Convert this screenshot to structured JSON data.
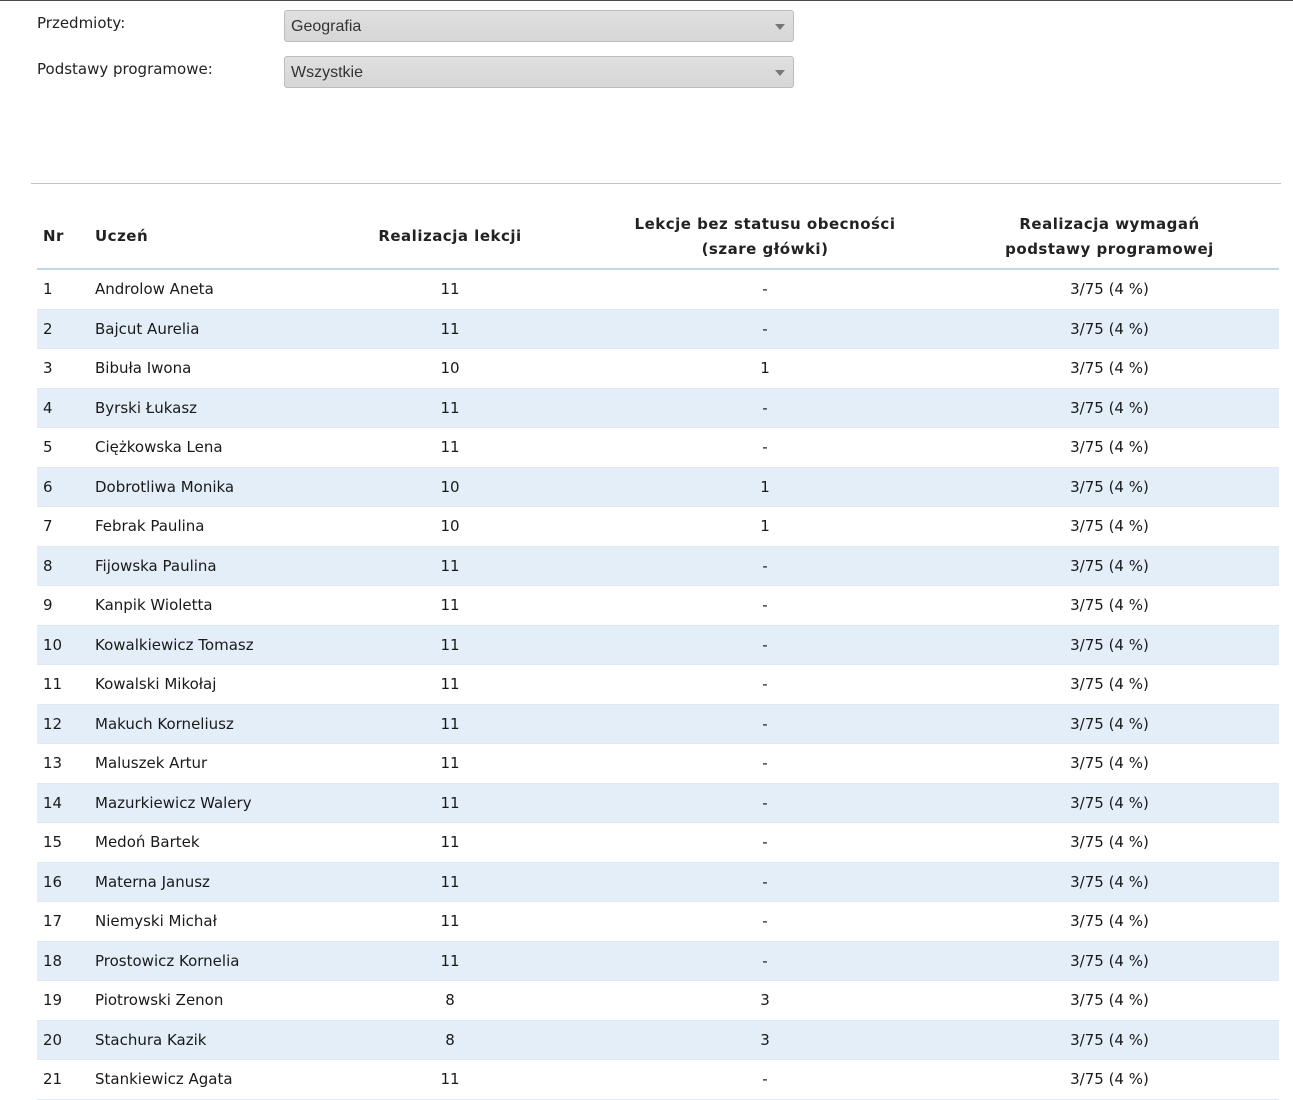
{
  "filters": {
    "subject": {
      "label": "Przedmioty:",
      "value": "Geografia"
    },
    "curriculum": {
      "label": "Podstawy programowe:",
      "value": "Wszystkie"
    }
  },
  "table": {
    "headers": {
      "nr": "Nr",
      "student": "Uczeń",
      "lessons": "Realizacja lekcji",
      "no_status_line1": "Lekcje bez statusu obecności",
      "no_status_line2": "(szare główki)",
      "requirements_line1": "Realizacja wymagań",
      "requirements_line2": "podstawy programowej"
    },
    "rows": [
      {
        "nr": "1",
        "name": "Androlow Aneta",
        "lessons": "11",
        "no_status": "-",
        "req": "3/75 (4 %)"
      },
      {
        "nr": "2",
        "name": "Bajcut Aurelia",
        "lessons": "11",
        "no_status": "-",
        "req": "3/75 (4 %)"
      },
      {
        "nr": "3",
        "name": "Bibuła Iwona",
        "lessons": "10",
        "no_status": "1",
        "req": "3/75 (4 %)"
      },
      {
        "nr": "4",
        "name": "Byrski Łukasz",
        "lessons": "11",
        "no_status": "-",
        "req": "3/75 (4 %)"
      },
      {
        "nr": "5",
        "name": "Ciężkowska Lena",
        "lessons": "11",
        "no_status": "-",
        "req": "3/75 (4 %)"
      },
      {
        "nr": "6",
        "name": "Dobrotliwa Monika",
        "lessons": "10",
        "no_status": "1",
        "req": "3/75 (4 %)"
      },
      {
        "nr": "7",
        "name": "Febrak Paulina",
        "lessons": "10",
        "no_status": "1",
        "req": "3/75 (4 %)"
      },
      {
        "nr": "8",
        "name": "Fijowska Paulina",
        "lessons": "11",
        "no_status": "-",
        "req": "3/75 (4 %)"
      },
      {
        "nr": "9",
        "name": "Kanpik Wioletta",
        "lessons": "11",
        "no_status": "-",
        "req": "3/75 (4 %)"
      },
      {
        "nr": "10",
        "name": "Kowalkiewicz Tomasz",
        "lessons": "11",
        "no_status": "-",
        "req": "3/75 (4 %)"
      },
      {
        "nr": "11",
        "name": "Kowalski Mikołaj",
        "lessons": "11",
        "no_status": "-",
        "req": "3/75 (4 %)"
      },
      {
        "nr": "12",
        "name": "Makuch Korneliusz",
        "lessons": "11",
        "no_status": "-",
        "req": "3/75 (4 %)"
      },
      {
        "nr": "13",
        "name": "Maluszek Artur",
        "lessons": "11",
        "no_status": "-",
        "req": "3/75 (4 %)"
      },
      {
        "nr": "14",
        "name": "Mazurkiewicz Walery",
        "lessons": "11",
        "no_status": "-",
        "req": "3/75 (4 %)"
      },
      {
        "nr": "15",
        "name": "Medoń Bartek",
        "lessons": "11",
        "no_status": "-",
        "req": "3/75 (4 %)"
      },
      {
        "nr": "16",
        "name": "Materna Janusz",
        "lessons": "11",
        "no_status": "-",
        "req": "3/75 (4 %)"
      },
      {
        "nr": "17",
        "name": "Niemyski Michał",
        "lessons": "11",
        "no_status": "-",
        "req": "3/75 (4 %)"
      },
      {
        "nr": "18",
        "name": "Prostowicz Kornelia",
        "lessons": "11",
        "no_status": "-",
        "req": "3/75 (4 %)"
      },
      {
        "nr": "19",
        "name": "Piotrowski Zenon",
        "lessons": "8",
        "no_status": "3",
        "req": "3/75 (4 %)"
      },
      {
        "nr": "20",
        "name": "Stachura Kazik",
        "lessons": "8",
        "no_status": "3",
        "req": "3/75 (4 %)"
      },
      {
        "nr": "21",
        "name": "Stankiewicz Agata",
        "lessons": "11",
        "no_status": "-",
        "req": "3/75 (4 %)"
      }
    ]
  }
}
